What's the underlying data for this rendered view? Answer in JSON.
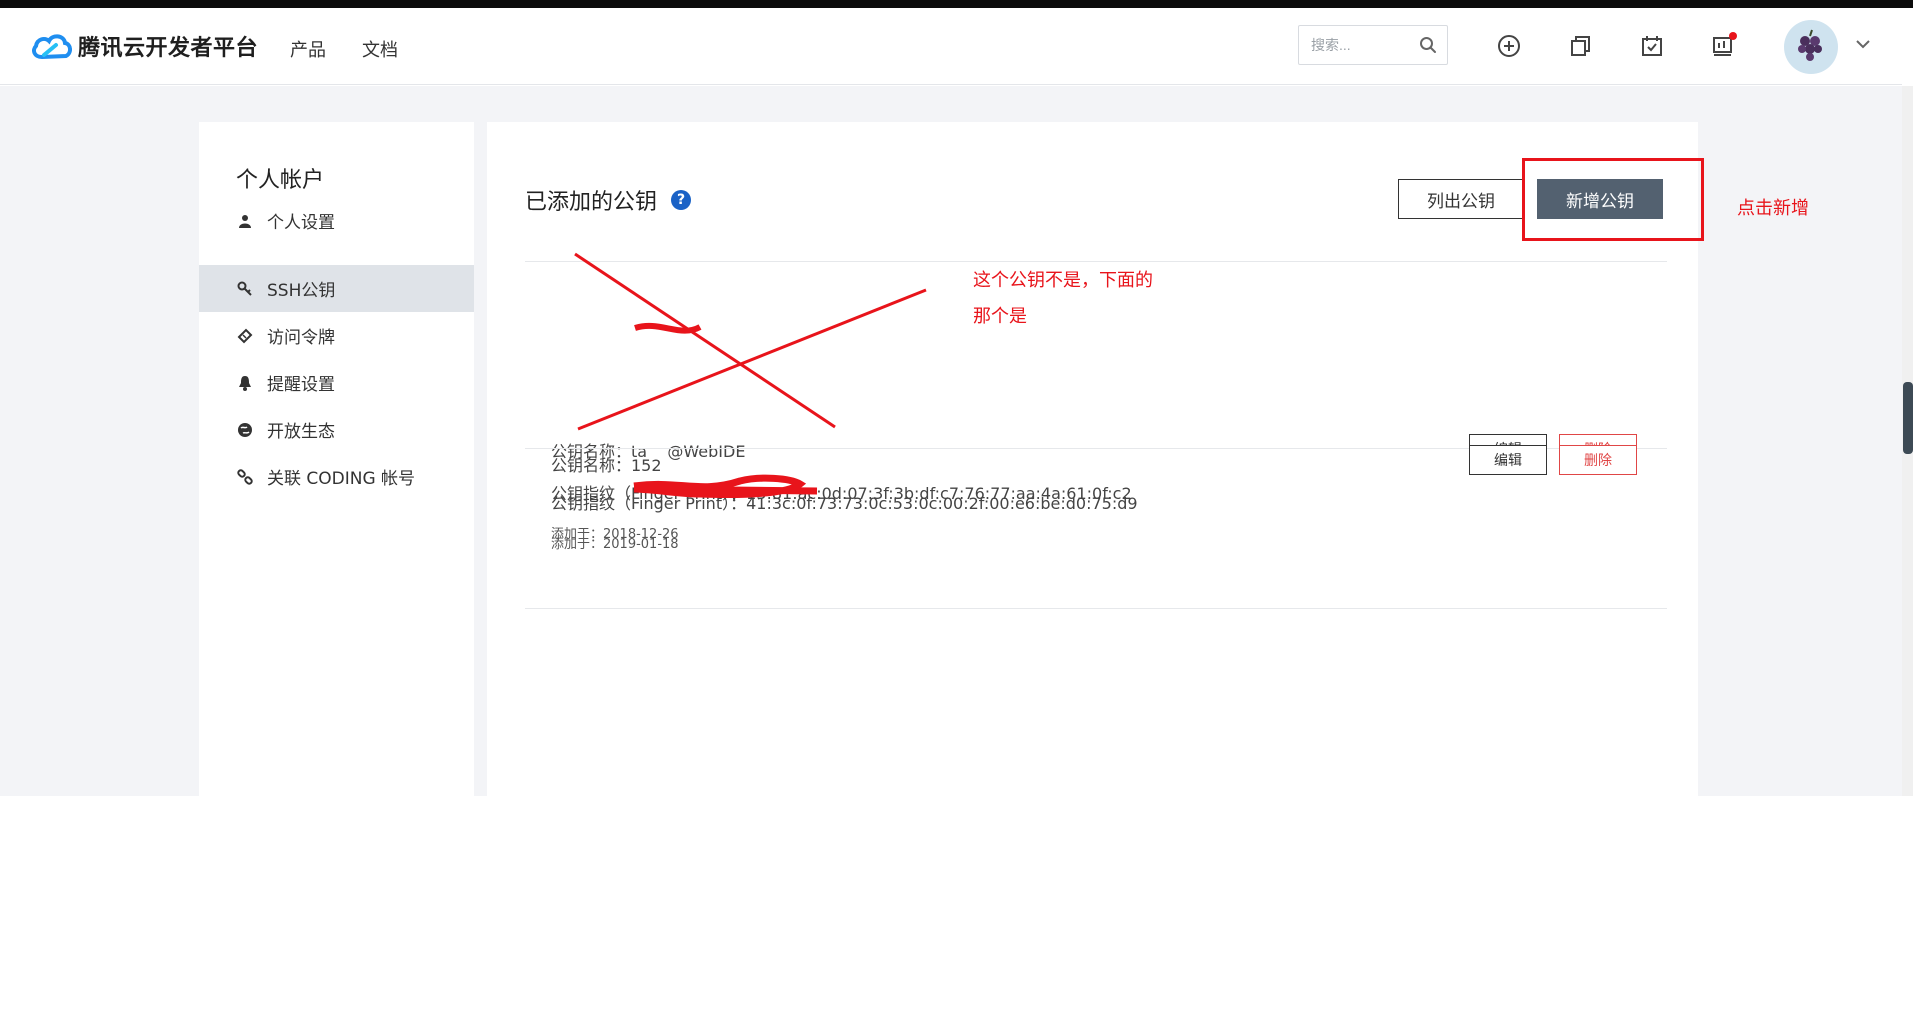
{
  "header": {
    "logo_text": "腾讯云开发者平台",
    "nav": [
      "产品",
      "文档"
    ],
    "search_placeholder": "搜索..."
  },
  "sidebar": {
    "title": "个人帐户",
    "items": [
      {
        "label": "个人设置",
        "icon": "user-icon"
      },
      {
        "label": "SSH公钥",
        "icon": "key-icon",
        "active": true
      },
      {
        "label": "访问令牌",
        "icon": "ticket-icon"
      },
      {
        "label": "提醒设置",
        "icon": "bell-icon"
      },
      {
        "label": "开放生态",
        "icon": "globe-icon"
      },
      {
        "label": "关联 CODING 帐号",
        "icon": "link-icon"
      }
    ]
  },
  "main": {
    "title": "已添加的公钥",
    "list_button": "列出公钥",
    "add_button": "新增公钥",
    "keys": [
      {
        "name_line": "公钥名称：ta    @WebIDE",
        "fingerprint_line": "公钥指纹（Finger Print）：13:81:ac:0d:07:3f:3b:df:c7:76:77:aa:4a:61:0f:c2",
        "date_line": "添加于：2018-12-26",
        "edit": "编辑",
        "delete": "删除"
      },
      {
        "name_line": "公钥名称：152",
        "fingerprint_line": "公钥指纹（Finger Print）：41:3c:0f:73:73:0c:53:0c:00:2f:00:e6:be:d0:75:d9",
        "date_line": "添加于：2019-01-18",
        "edit": "编辑",
        "delete": "删除"
      }
    ]
  },
  "annotations": {
    "click_add": "点击新增",
    "note_line1": "这个公钥不是，下面的",
    "note_line2": "那个是"
  },
  "colors": {
    "accent": "#1a62c6",
    "primary_button": "#536170",
    "danger": "#e04646",
    "annotation": "#e8141b",
    "active_item_bg": "#dfe3e8"
  }
}
